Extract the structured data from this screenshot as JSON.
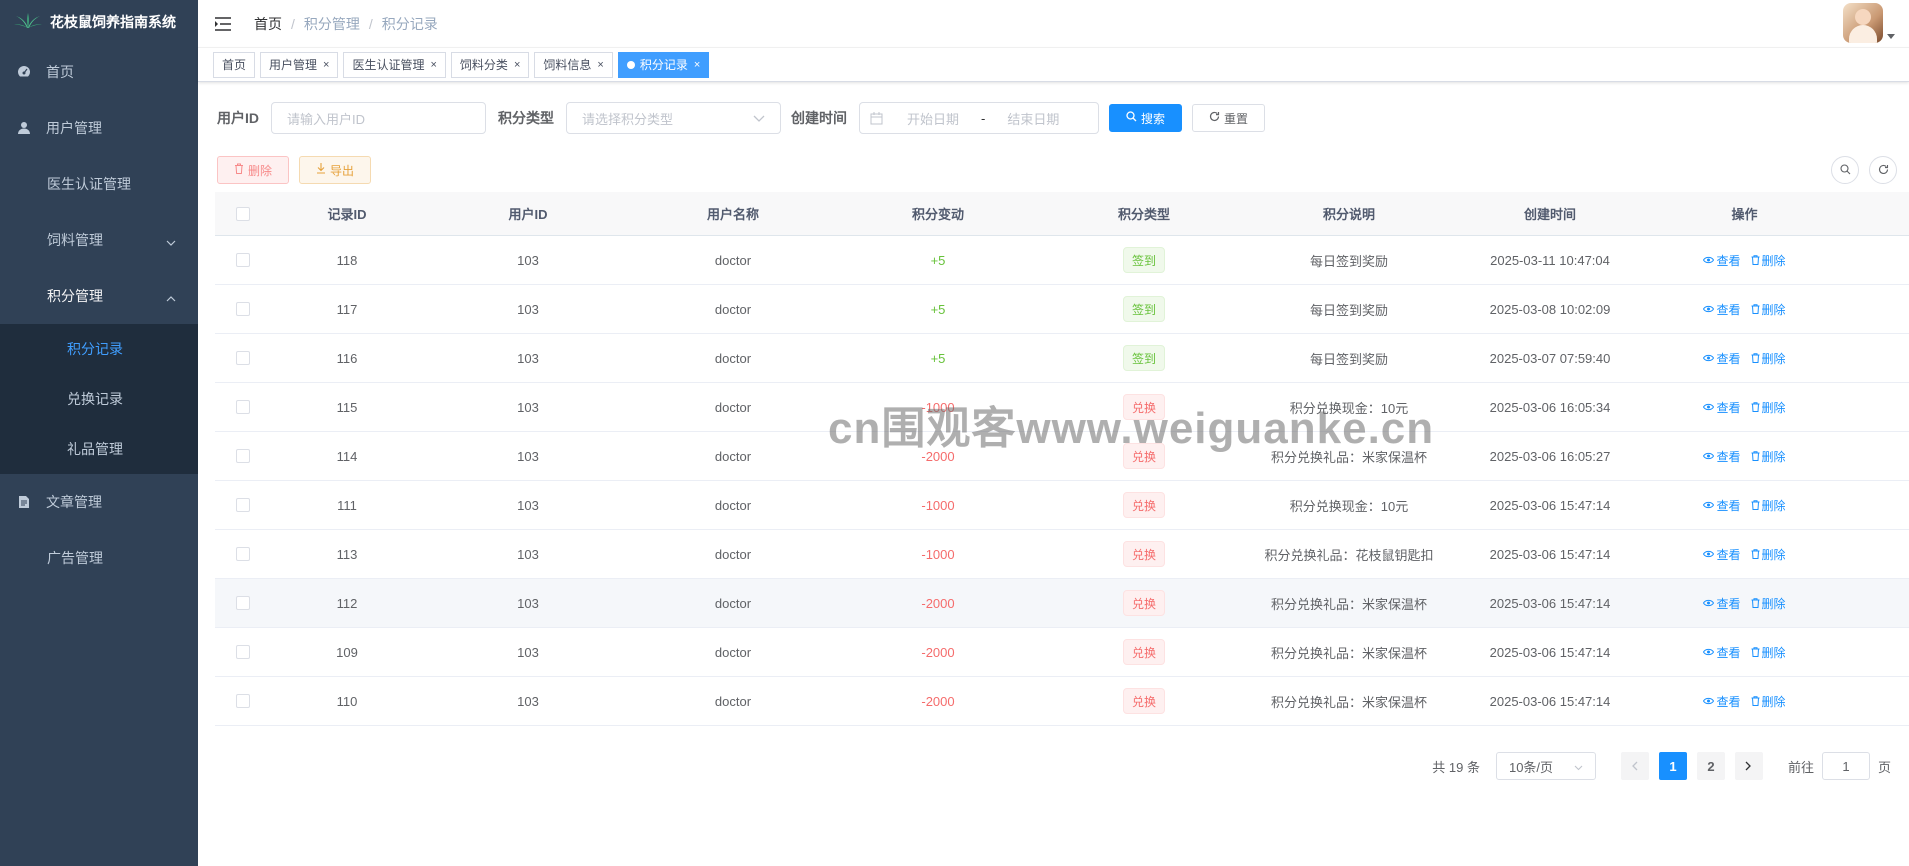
{
  "app": {
    "title": "花枝鼠饲养指南系统"
  },
  "sidebar": {
    "items": [
      {
        "label": "首页",
        "icon": "dashboard-icon"
      },
      {
        "label": "用户管理",
        "icon": "user-icon"
      },
      {
        "label": "医生认证管理"
      },
      {
        "label": "饲料管理"
      },
      {
        "label": "积分管理"
      },
      {
        "label": "文章管理",
        "icon": "document-icon"
      },
      {
        "label": "广告管理"
      }
    ],
    "sub": [
      {
        "label": "积分记录"
      },
      {
        "label": "兑换记录"
      },
      {
        "label": "礼品管理"
      }
    ]
  },
  "breadcrumb": [
    "首页",
    "积分管理",
    "积分记录"
  ],
  "tags": [
    {
      "label": "首页"
    },
    {
      "label": "用户管理"
    },
    {
      "label": "医生认证管理"
    },
    {
      "label": "饲料分类"
    },
    {
      "label": "饲料信息"
    },
    {
      "label": "积分记录"
    }
  ],
  "search": {
    "user_id_label": "用户ID",
    "user_id_placeholder": "请输入用户ID",
    "type_label": "积分类型",
    "type_placeholder": "请选择积分类型",
    "time_label": "创建时间",
    "start_placeholder": "开始日期",
    "range_sep": "-",
    "end_placeholder": "结束日期",
    "search_btn": "搜索",
    "reset_btn": "重置"
  },
  "toolbar": {
    "delete_btn": "删除",
    "export_btn": "导出"
  },
  "table": {
    "headers": [
      "记录ID",
      "用户ID",
      "用户名称",
      "积分变动",
      "积分类型",
      "积分说明",
      "创建时间",
      "操作"
    ],
    "view_label": "查看",
    "delete_label": "删除",
    "rows": [
      {
        "id": "118",
        "uid": "103",
        "name": "doctor",
        "change": "+5",
        "type": "签到",
        "desc": "每日签到奖励",
        "time": "2025-03-11 10:47:04"
      },
      {
        "id": "117",
        "uid": "103",
        "name": "doctor",
        "change": "+5",
        "type": "签到",
        "desc": "每日签到奖励",
        "time": "2025-03-08 10:02:09"
      },
      {
        "id": "116",
        "uid": "103",
        "name": "doctor",
        "change": "+5",
        "type": "签到",
        "desc": "每日签到奖励",
        "time": "2025-03-07 07:59:40"
      },
      {
        "id": "115",
        "uid": "103",
        "name": "doctor",
        "change": "-1000",
        "type": "兑换",
        "desc": "积分兑换现金：10元",
        "time": "2025-03-06 16:05:34"
      },
      {
        "id": "114",
        "uid": "103",
        "name": "doctor",
        "change": "-2000",
        "type": "兑换",
        "desc": "积分兑换礼品：米家保温杯",
        "time": "2025-03-06 16:05:27"
      },
      {
        "id": "111",
        "uid": "103",
        "name": "doctor",
        "change": "-1000",
        "type": "兑换",
        "desc": "积分兑换现金：10元",
        "time": "2025-03-06 15:47:14"
      },
      {
        "id": "113",
        "uid": "103",
        "name": "doctor",
        "change": "-1000",
        "type": "兑换",
        "desc": "积分兑换礼品：花枝鼠钥匙扣",
        "time": "2025-03-06 15:47:14"
      },
      {
        "id": "112",
        "uid": "103",
        "name": "doctor",
        "change": "-2000",
        "type": "兑换",
        "desc": "积分兑换礼品：米家保温杯",
        "time": "2025-03-06 15:47:14"
      },
      {
        "id": "109",
        "uid": "103",
        "name": "doctor",
        "change": "-2000",
        "type": "兑换",
        "desc": "积分兑换礼品：米家保温杯",
        "time": "2025-03-06 15:47:14"
      },
      {
        "id": "110",
        "uid": "103",
        "name": "doctor",
        "change": "-2000",
        "type": "兑换",
        "desc": "积分兑换礼品：米家保温杯",
        "time": "2025-03-06 15:47:14"
      }
    ]
  },
  "pagination": {
    "total": "共 19 条",
    "page_size": "10条/页",
    "pages": [
      "1",
      "2"
    ],
    "goto_label": "前往",
    "goto_value": "1",
    "page_unit": "页"
  },
  "watermark": "cn围观客www.weiguanke.cn",
  "colors": {
    "sidebar": "#304156",
    "primary": "#1890ff",
    "success": "#67c23a",
    "danger": "#f56c6c"
  }
}
